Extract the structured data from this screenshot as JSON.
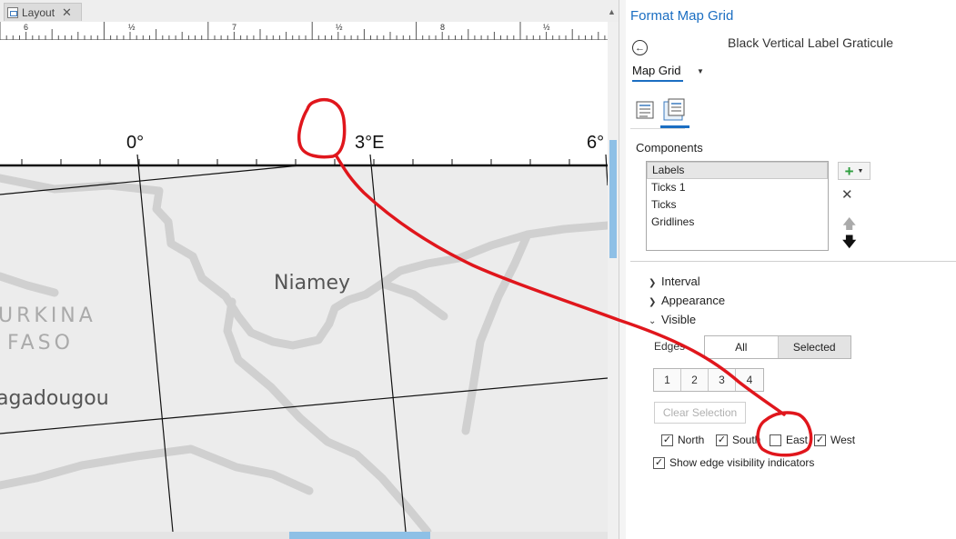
{
  "layout_tab": {
    "label": "Layout",
    "close_glyph": "✕"
  },
  "ruler": {
    "labels": [
      "6",
      "½",
      "7",
      "½",
      "8",
      "½"
    ]
  },
  "map": {
    "labels": {
      "lon_0": "0°",
      "lon_3e": "3°E",
      "lon_6": "6°",
      "city_niamey": "Niamey",
      "country_burkina_line1": "URKINA",
      "country_burkina_line2": "FASO",
      "city_ouagadougou": "agadougou"
    }
  },
  "format_pane": {
    "title": "Format Map Grid",
    "element_name": "Black Vertical Label Graticule",
    "dropdown_label": "Map Grid",
    "components_label": "Components",
    "components": [
      "Labels",
      "Ticks 1",
      "Ticks",
      "Gridlines"
    ],
    "sections": {
      "interval": "Interval",
      "appearance": "Appearance",
      "visible": "Visible"
    },
    "edges_label": "Edges",
    "edges_all": "All",
    "edges_selected": "Selected",
    "edge_numbers": [
      "1",
      "2",
      "3",
      "4"
    ],
    "clear_selection": "Clear Selection",
    "checkboxes": {
      "north": {
        "label": "North",
        "checked": true
      },
      "south": {
        "label": "South",
        "checked": true
      },
      "east": {
        "label": "East",
        "checked": false
      },
      "west": {
        "label": "West",
        "checked": true
      },
      "indicators": {
        "label": "Show edge visibility indicators",
        "checked": true
      }
    },
    "icons": {
      "back": "back-arrow-icon",
      "add": "add-icon",
      "remove": "remove-icon",
      "move_up": "move-up-icon",
      "move_down": "move-down-icon"
    }
  },
  "colors": {
    "accent": "#1b6ec2",
    "annotation": "#e0161c",
    "scroll_thumb": "#8ec0e6"
  }
}
